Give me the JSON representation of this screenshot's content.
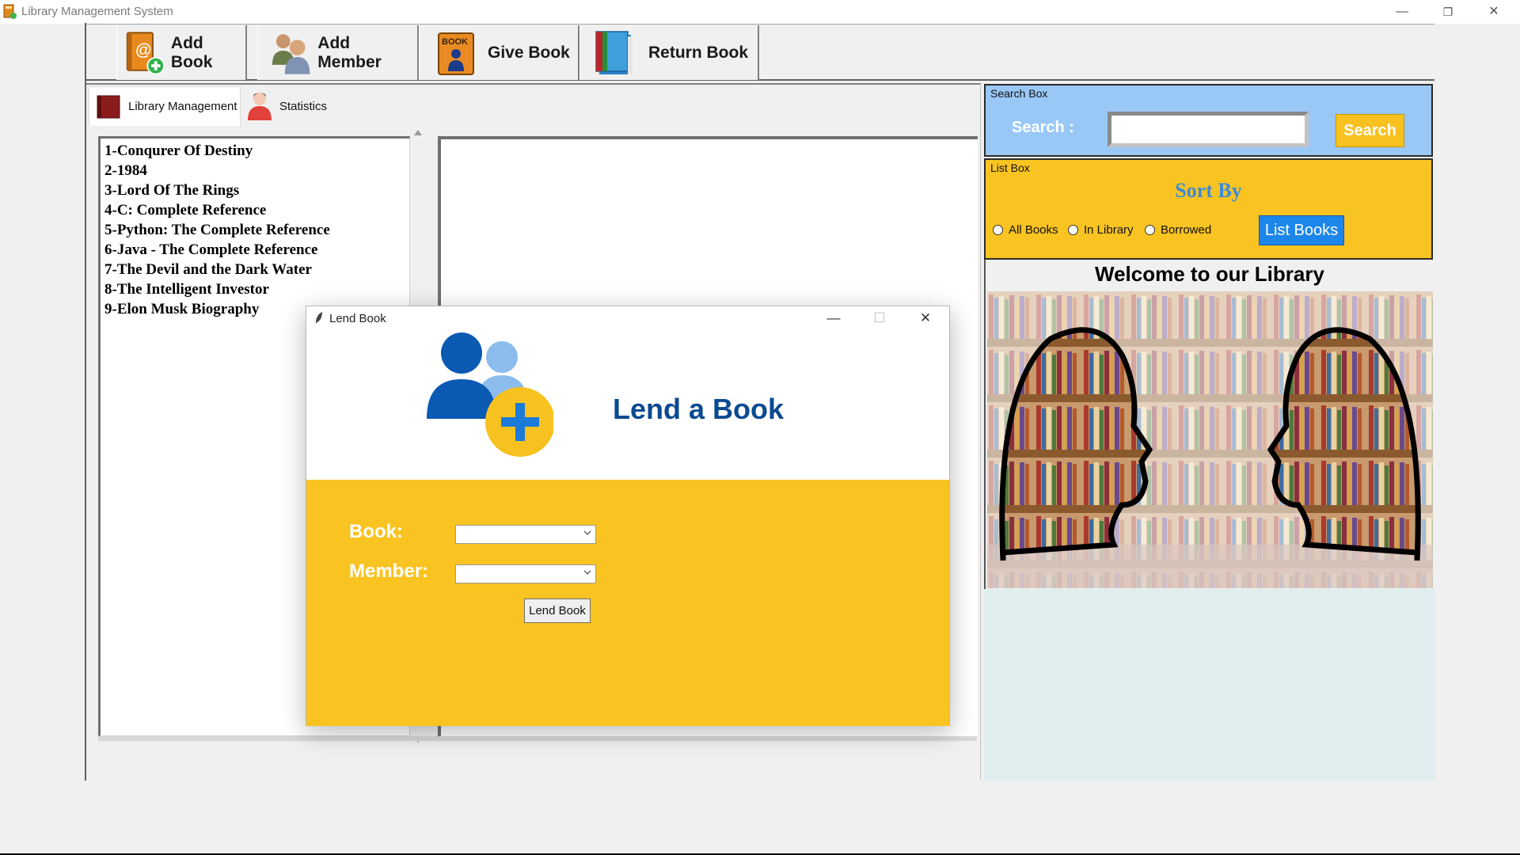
{
  "window": {
    "title": "Library Management System",
    "controls": {
      "minimize": "—",
      "restore": "❐",
      "close": "✕"
    }
  },
  "toolbar": {
    "buttons": [
      {
        "label": "Add Book",
        "icon": "add-book-icon"
      },
      {
        "label": "Add Member",
        "icon": "add-member-icon"
      },
      {
        "label": "Give Book",
        "icon": "give-book-icon"
      },
      {
        "label": "Return Book",
        "icon": "return-book-icon"
      }
    ]
  },
  "tabs": [
    {
      "label": "Library Management",
      "active": true
    },
    {
      "label": "Statistics",
      "active": false
    }
  ],
  "book_list": [
    "1-Conqurer Of Destiny",
    "2-1984",
    "3-Lord Of The Rings",
    "4-C: Complete Reference",
    "5-Python: The Complete Reference",
    "6-Java - The Complete Reference",
    "7-The Devil and the Dark Water",
    "8-The Intelligent Investor",
    "9-Elon Musk Biography"
  ],
  "search_box": {
    "group_label": "Search Box",
    "label": "Search :",
    "value": "",
    "button": "Search"
  },
  "list_box": {
    "group_label": "List Box",
    "sort_title": "Sort By",
    "radios": [
      "All Books",
      "In Library",
      "Borrowed"
    ],
    "button": "List Books"
  },
  "welcome": {
    "title": "Welcome to our Library"
  },
  "dialog": {
    "title": "Lend Book",
    "heading": "Lend a Book",
    "book_label": "Book:",
    "book_value": "",
    "member_label": "Member:",
    "member_value": "",
    "submit": "Lend Book",
    "controls": {
      "minimize": "—",
      "maximize": "☐",
      "close": "✕"
    }
  },
  "colors": {
    "accent_yellow": "#f9c321",
    "search_blue": "#99c8f7",
    "list_button_blue": "#1c86ea",
    "heading_navy": "#0a4a91",
    "sort_title_blue": "#3d8bd6"
  }
}
